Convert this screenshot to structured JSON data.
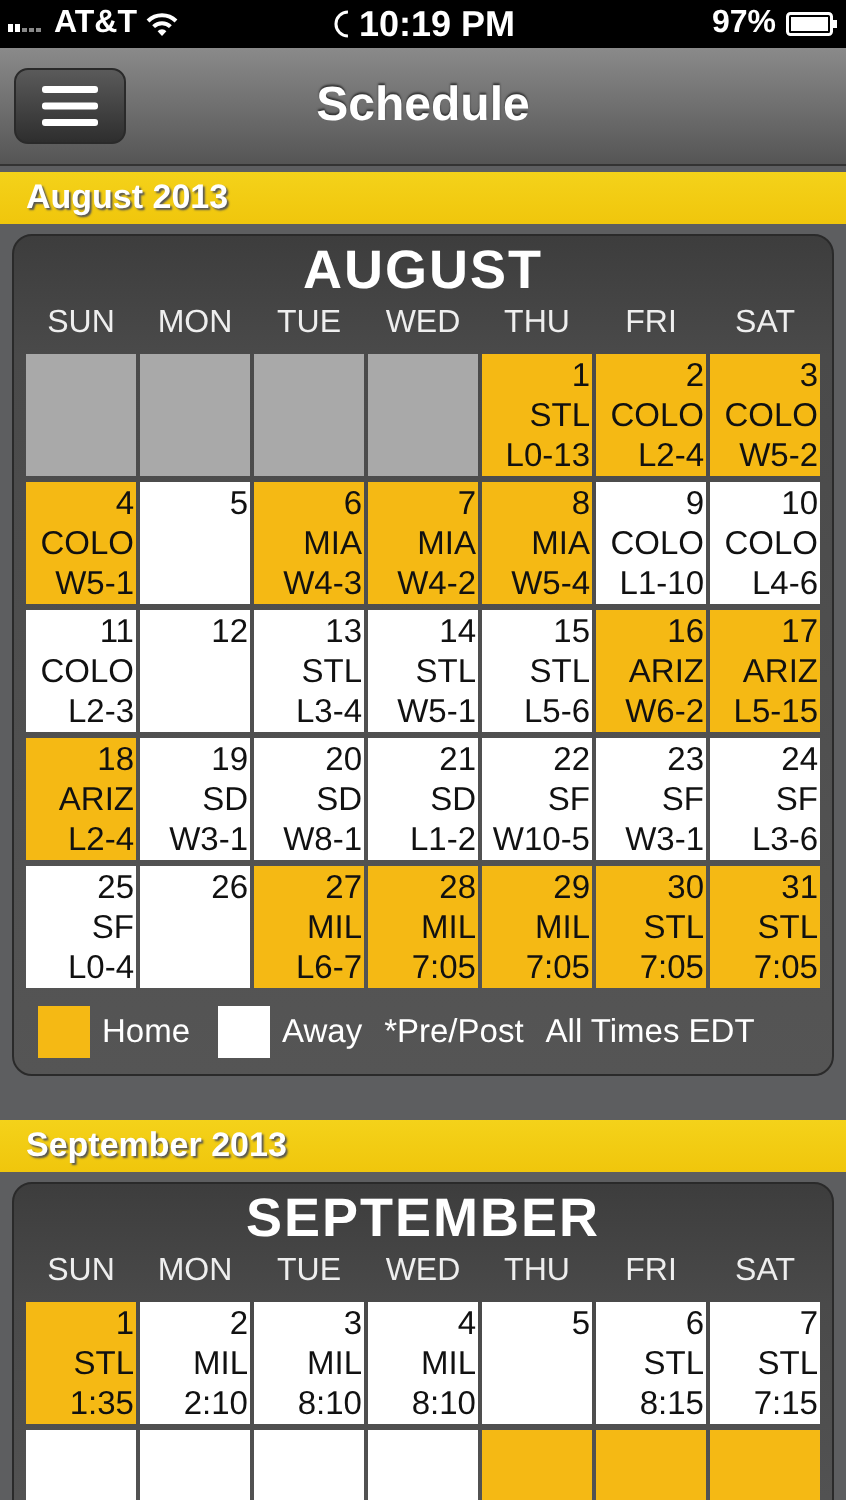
{
  "status_bar": {
    "carrier": "AT&T",
    "time": "10:19 PM",
    "battery": "97%"
  },
  "nav": {
    "title": "Schedule"
  },
  "months": [
    {
      "band": "August 2013",
      "title": "AUGUST",
      "weekdays": [
        "SUN",
        "MON",
        "TUE",
        "WED",
        "THU",
        "FRI",
        "SAT"
      ],
      "weeks": [
        [
          {
            "kind": "blank"
          },
          {
            "kind": "blank"
          },
          {
            "kind": "blank"
          },
          {
            "kind": "blank"
          },
          {
            "kind": "day",
            "day": "1",
            "team": "STL",
            "result": "L0-13",
            "home": true
          },
          {
            "kind": "day",
            "day": "2",
            "team": "COLO",
            "result": "L2-4",
            "home": true
          },
          {
            "kind": "day",
            "day": "3",
            "team": "COLO",
            "result": "W5-2",
            "home": true
          }
        ],
        [
          {
            "kind": "day",
            "day": "4",
            "team": "COLO",
            "result": "W5-1",
            "home": true
          },
          {
            "kind": "day",
            "day": "5",
            "home": false
          },
          {
            "kind": "day",
            "day": "6",
            "team": "MIA",
            "result": "W4-3",
            "home": true
          },
          {
            "kind": "day",
            "day": "7",
            "team": "MIA",
            "result": "W4-2",
            "home": true
          },
          {
            "kind": "day",
            "day": "8",
            "team": "MIA",
            "result": "W5-4",
            "home": true
          },
          {
            "kind": "day",
            "day": "9",
            "team": "COLO",
            "result": "L1-10",
            "home": false
          },
          {
            "kind": "day",
            "day": "10",
            "team": "COLO",
            "result": "L4-6",
            "home": false
          }
        ],
        [
          {
            "kind": "day",
            "day": "11",
            "team": "COLO",
            "result": "L2-3",
            "home": false
          },
          {
            "kind": "day",
            "day": "12",
            "home": false
          },
          {
            "kind": "day",
            "day": "13",
            "team": "STL",
            "result": "L3-4",
            "home": false
          },
          {
            "kind": "day",
            "day": "14",
            "team": "STL",
            "result": "W5-1",
            "home": false
          },
          {
            "kind": "day",
            "day": "15",
            "team": "STL",
            "result": "L5-6",
            "home": false
          },
          {
            "kind": "day",
            "day": "16",
            "team": "ARIZ",
            "result": "W6-2",
            "home": true
          },
          {
            "kind": "day",
            "day": "17",
            "team": "ARIZ",
            "result": "L5-15",
            "home": true
          }
        ],
        [
          {
            "kind": "day",
            "day": "18",
            "team": "ARIZ",
            "result": "L2-4",
            "home": true
          },
          {
            "kind": "day",
            "day": "19",
            "team": "SD",
            "result": "W3-1",
            "home": false
          },
          {
            "kind": "day",
            "day": "20",
            "team": "SD",
            "result": "W8-1",
            "home": false
          },
          {
            "kind": "day",
            "day": "21",
            "team": "SD",
            "result": "L1-2",
            "home": false
          },
          {
            "kind": "day",
            "day": "22",
            "team": "SF",
            "result": "W10-5",
            "home": false
          },
          {
            "kind": "day",
            "day": "23",
            "team": "SF",
            "result": "W3-1",
            "home": false
          },
          {
            "kind": "day",
            "day": "24",
            "team": "SF",
            "result": "L3-6",
            "home": false
          }
        ],
        [
          {
            "kind": "day",
            "day": "25",
            "team": "SF",
            "result": "L0-4",
            "home": false
          },
          {
            "kind": "day",
            "day": "26",
            "home": false
          },
          {
            "kind": "day",
            "day": "27",
            "team": "MIL",
            "result": "L6-7",
            "home": true
          },
          {
            "kind": "day",
            "day": "28",
            "team": "MIL",
            "result": "7:05",
            "home": true
          },
          {
            "kind": "day",
            "day": "29",
            "team": "MIL",
            "result": "7:05",
            "home": true
          },
          {
            "kind": "day",
            "day": "30",
            "team": "STL",
            "result": "7:05",
            "home": true
          },
          {
            "kind": "day",
            "day": "31",
            "team": "STL",
            "result": "7:05",
            "home": true
          }
        ]
      ],
      "legend": {
        "home": "Home",
        "away": "Away",
        "note": "*Pre/Post",
        "times": "All Times EDT"
      }
    },
    {
      "band": "September 2013",
      "title": "SEPTEMBER",
      "weekdays": [
        "SUN",
        "MON",
        "TUE",
        "WED",
        "THU",
        "FRI",
        "SAT"
      ],
      "weeks": [
        [
          {
            "kind": "day",
            "day": "1",
            "team": "STL",
            "result": "1:35",
            "home": true
          },
          {
            "kind": "day",
            "day": "2",
            "team": "MIL",
            "result": "2:10",
            "home": false
          },
          {
            "kind": "day",
            "day": "3",
            "team": "MIL",
            "result": "8:10",
            "home": false
          },
          {
            "kind": "day",
            "day": "4",
            "team": "MIL",
            "result": "8:10",
            "home": false
          },
          {
            "kind": "day",
            "day": "5",
            "home": false
          },
          {
            "kind": "day",
            "day": "6",
            "team": "STL",
            "result": "8:15",
            "home": false
          },
          {
            "kind": "day",
            "day": "7",
            "team": "STL",
            "result": "7:15",
            "home": false
          }
        ],
        [
          {
            "kind": "stub",
            "home": false
          },
          {
            "kind": "stub",
            "home": false
          },
          {
            "kind": "stub",
            "home": false
          },
          {
            "kind": "stub",
            "home": false
          },
          {
            "kind": "stub",
            "home": true
          },
          {
            "kind": "stub",
            "home": true
          },
          {
            "kind": "stub",
            "home": true
          }
        ]
      ]
    }
  ]
}
